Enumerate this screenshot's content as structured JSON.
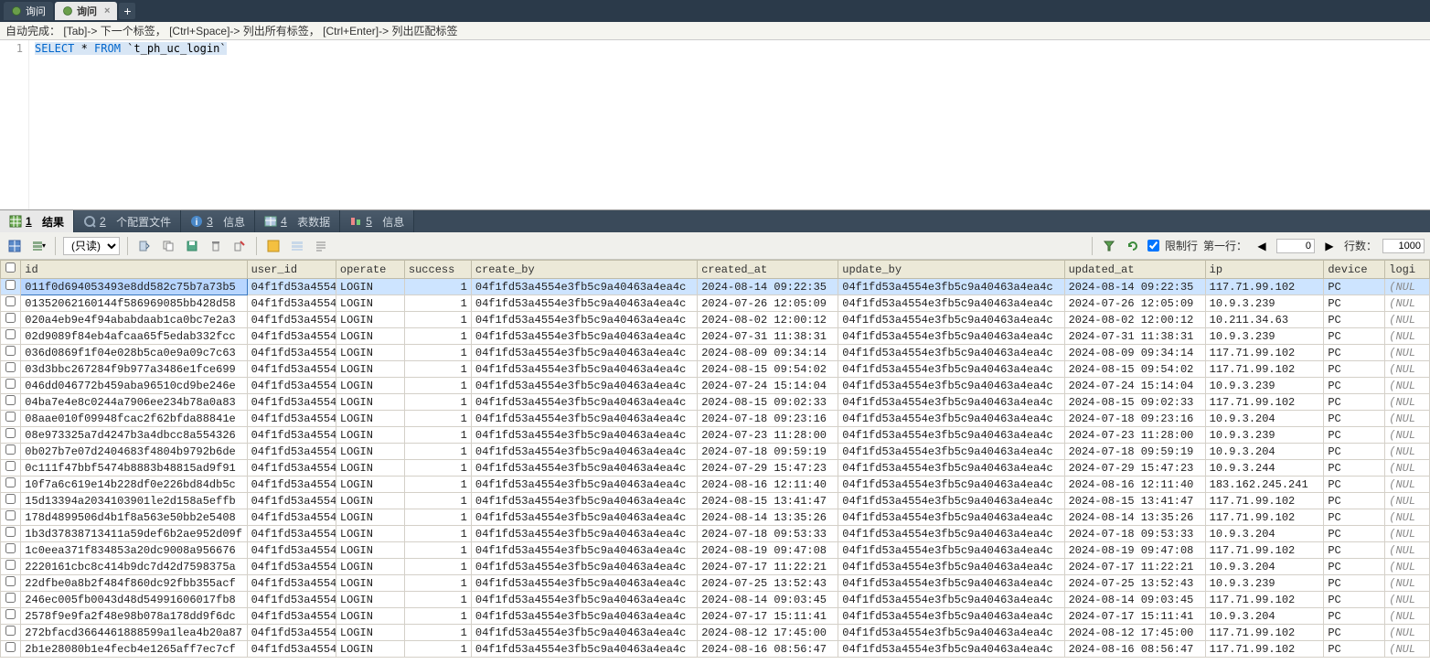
{
  "tabs": [
    {
      "label": "询问",
      "active": false
    },
    {
      "label": "询问",
      "active": true
    }
  ],
  "hints": {
    "auto": "自动完成：",
    "tab": "[Tab]-> 下一个标签，",
    "ctrlspace": "[Ctrl+Space]-> 列出所有标签，",
    "ctrlenter": "[Ctrl+Enter]-> 列出匹配标签"
  },
  "editor": {
    "line": "1",
    "sql_select": "SELECT",
    "sql_star": " * ",
    "sql_from": "FROM",
    "sql_table": " `t_ph_uc_login`"
  },
  "result_tabs": [
    {
      "num": "1",
      "label": "结果",
      "active": true
    },
    {
      "num": "2",
      "label": "个配置文件",
      "active": false
    },
    {
      "num": "3",
      "label": "信息",
      "active": false
    },
    {
      "num": "4",
      "label": "表数据",
      "active": false
    },
    {
      "num": "5",
      "label": "信息",
      "active": false
    }
  ],
  "toolbar": {
    "mode": "(只读)",
    "limit_label": "限制行",
    "firstrow_label": "第一行：",
    "firstrow_value": "0",
    "rows_label": "行数：",
    "rows_value": "1000"
  },
  "columns": [
    "id",
    "user_id",
    "operate",
    "success",
    "create_by",
    "created_at",
    "update_by",
    "updated_at",
    "ip",
    "device",
    "logi"
  ],
  "rows": [
    {
      "id": "011f0d694053493e8dd582c75b7a73b5",
      "user_id": "04f1fd53a4554",
      "operate": "LOGIN",
      "success": "1",
      "create_by": "04f1fd53a4554e3fb5c9a40463a4ea4c",
      "created_at": "2024-08-14 09:22:35",
      "update_by": "04f1fd53a4554e3fb5c9a40463a4ea4c",
      "updated_at": "2024-08-14 09:22:35",
      "ip": "117.71.99.102",
      "device": "PC",
      "login": "(NUL"
    },
    {
      "id": "01352062160144f586969085bb428d58",
      "user_id": "04f1fd53a4554",
      "operate": "LOGIN",
      "success": "1",
      "create_by": "04f1fd53a4554e3fb5c9a40463a4ea4c",
      "created_at": "2024-07-26 12:05:09",
      "update_by": "04f1fd53a4554e3fb5c9a40463a4ea4c",
      "updated_at": "2024-07-26 12:05:09",
      "ip": "10.9.3.239",
      "device": "PC",
      "login": "(NUL"
    },
    {
      "id": "020a4eb9e4f94ababdaab1ca0bc7e2a3",
      "user_id": "04f1fd53a4554",
      "operate": "LOGIN",
      "success": "1",
      "create_by": "04f1fd53a4554e3fb5c9a40463a4ea4c",
      "created_at": "2024-08-02 12:00:12",
      "update_by": "04f1fd53a4554e3fb5c9a40463a4ea4c",
      "updated_at": "2024-08-02 12:00:12",
      "ip": "10.211.34.63",
      "device": "PC",
      "login": "(NUL"
    },
    {
      "id": "02d9089f84eb4afcaa65f5edab332fcc",
      "user_id": "04f1fd53a4554",
      "operate": "LOGIN",
      "success": "1",
      "create_by": "04f1fd53a4554e3fb5c9a40463a4ea4c",
      "created_at": "2024-07-31 11:38:31",
      "update_by": "04f1fd53a4554e3fb5c9a40463a4ea4c",
      "updated_at": "2024-07-31 11:38:31",
      "ip": "10.9.3.239",
      "device": "PC",
      "login": "(NUL"
    },
    {
      "id": "036d0869f1f04e028b5ca0e9a09c7c63",
      "user_id": "04f1fd53a4554",
      "operate": "LOGIN",
      "success": "1",
      "create_by": "04f1fd53a4554e3fb5c9a40463a4ea4c",
      "created_at": "2024-08-09 09:34:14",
      "update_by": "04f1fd53a4554e3fb5c9a40463a4ea4c",
      "updated_at": "2024-08-09 09:34:14",
      "ip": "117.71.99.102",
      "device": "PC",
      "login": "(NUL"
    },
    {
      "id": "03d3bbc267284f9b977a3486e1fce699",
      "user_id": "04f1fd53a4554",
      "operate": "LOGIN",
      "success": "1",
      "create_by": "04f1fd53a4554e3fb5c9a40463a4ea4c",
      "created_at": "2024-08-15 09:54:02",
      "update_by": "04f1fd53a4554e3fb5c9a40463a4ea4c",
      "updated_at": "2024-08-15 09:54:02",
      "ip": "117.71.99.102",
      "device": "PC",
      "login": "(NUL"
    },
    {
      "id": "046dd046772b459aba96510cd9be246e",
      "user_id": "04f1fd53a4554",
      "operate": "LOGIN",
      "success": "1",
      "create_by": "04f1fd53a4554e3fb5c9a40463a4ea4c",
      "created_at": "2024-07-24 15:14:04",
      "update_by": "04f1fd53a4554e3fb5c9a40463a4ea4c",
      "updated_at": "2024-07-24 15:14:04",
      "ip": "10.9.3.239",
      "device": "PC",
      "login": "(NUL"
    },
    {
      "id": "04ba7e4e8c0244a7906ee234b78a0a83",
      "user_id": "04f1fd53a4554",
      "operate": "LOGIN",
      "success": "1",
      "create_by": "04f1fd53a4554e3fb5c9a40463a4ea4c",
      "created_at": "2024-08-15 09:02:33",
      "update_by": "04f1fd53a4554e3fb5c9a40463a4ea4c",
      "updated_at": "2024-08-15 09:02:33",
      "ip": "117.71.99.102",
      "device": "PC",
      "login": "(NUL"
    },
    {
      "id": "08aae010f09948fcac2f62bfda88841e",
      "user_id": "04f1fd53a4554",
      "operate": "LOGIN",
      "success": "1",
      "create_by": "04f1fd53a4554e3fb5c9a40463a4ea4c",
      "created_at": "2024-07-18 09:23:16",
      "update_by": "04f1fd53a4554e3fb5c9a40463a4ea4c",
      "updated_at": "2024-07-18 09:23:16",
      "ip": "10.9.3.204",
      "device": "PC",
      "login": "(NUL"
    },
    {
      "id": "08e973325a7d4247b3a4dbcc8a554326",
      "user_id": "04f1fd53a4554",
      "operate": "LOGIN",
      "success": "1",
      "create_by": "04f1fd53a4554e3fb5c9a40463a4ea4c",
      "created_at": "2024-07-23 11:28:00",
      "update_by": "04f1fd53a4554e3fb5c9a40463a4ea4c",
      "updated_at": "2024-07-23 11:28:00",
      "ip": "10.9.3.239",
      "device": "PC",
      "login": "(NUL"
    },
    {
      "id": "0b027b7e07d2404683f4804b9792b6de",
      "user_id": "04f1fd53a4554",
      "operate": "LOGIN",
      "success": "1",
      "create_by": "04f1fd53a4554e3fb5c9a40463a4ea4c",
      "created_at": "2024-07-18 09:59:19",
      "update_by": "04f1fd53a4554e3fb5c9a40463a4ea4c",
      "updated_at": "2024-07-18 09:59:19",
      "ip": "10.9.3.204",
      "device": "PC",
      "login": "(NUL"
    },
    {
      "id": "0c111f47bbf5474b8883b48815ad9f91",
      "user_id": "04f1fd53a4554",
      "operate": "LOGIN",
      "success": "1",
      "create_by": "04f1fd53a4554e3fb5c9a40463a4ea4c",
      "created_at": "2024-07-29 15:47:23",
      "update_by": "04f1fd53a4554e3fb5c9a40463a4ea4c",
      "updated_at": "2024-07-29 15:47:23",
      "ip": "10.9.3.244",
      "device": "PC",
      "login": "(NUL"
    },
    {
      "id": "10f7a6c619e14b228df0e226bd84db5c",
      "user_id": "04f1fd53a4554",
      "operate": "LOGIN",
      "success": "1",
      "create_by": "04f1fd53a4554e3fb5c9a40463a4ea4c",
      "created_at": "2024-08-16 12:11:40",
      "update_by": "04f1fd53a4554e3fb5c9a40463a4ea4c",
      "updated_at": "2024-08-16 12:11:40",
      "ip": "183.162.245.241",
      "device": "PC",
      "login": "(NUL"
    },
    {
      "id": "15d13394a2034103901le2d158a5effb",
      "user_id": "04f1fd53a4554",
      "operate": "LOGIN",
      "success": "1",
      "create_by": "04f1fd53a4554e3fb5c9a40463a4ea4c",
      "created_at": "2024-08-15 13:41:47",
      "update_by": "04f1fd53a4554e3fb5c9a40463a4ea4c",
      "updated_at": "2024-08-15 13:41:47",
      "ip": "117.71.99.102",
      "device": "PC",
      "login": "(NUL"
    },
    {
      "id": "178d4899506d4b1f8a563e50bb2e5408",
      "user_id": "04f1fd53a4554",
      "operate": "LOGIN",
      "success": "1",
      "create_by": "04f1fd53a4554e3fb5c9a40463a4ea4c",
      "created_at": "2024-08-14 13:35:26",
      "update_by": "04f1fd53a4554e3fb5c9a40463a4ea4c",
      "updated_at": "2024-08-14 13:35:26",
      "ip": "117.71.99.102",
      "device": "PC",
      "login": "(NUL"
    },
    {
      "id": "1b3d37838713411a59def6b2ae952d09f",
      "user_id": "04f1fd53a4554",
      "operate": "LOGIN",
      "success": "1",
      "create_by": "04f1fd53a4554e3fb5c9a40463a4ea4c",
      "created_at": "2024-07-18 09:53:33",
      "update_by": "04f1fd53a4554e3fb5c9a40463a4ea4c",
      "updated_at": "2024-07-18 09:53:33",
      "ip": "10.9.3.204",
      "device": "PC",
      "login": "(NUL"
    },
    {
      "id": "1c0eea371f834853a20dc9008a956676",
      "user_id": "04f1fd53a4554",
      "operate": "LOGIN",
      "success": "1",
      "create_by": "04f1fd53a4554e3fb5c9a40463a4ea4c",
      "created_at": "2024-08-19 09:47:08",
      "update_by": "04f1fd53a4554e3fb5c9a40463a4ea4c",
      "updated_at": "2024-08-19 09:47:08",
      "ip": "117.71.99.102",
      "device": "PC",
      "login": "(NUL"
    },
    {
      "id": "2220161cbc8c414b9dc7d42d7598375a",
      "user_id": "04f1fd53a4554",
      "operate": "LOGIN",
      "success": "1",
      "create_by": "04f1fd53a4554e3fb5c9a40463a4ea4c",
      "created_at": "2024-07-17 11:22:21",
      "update_by": "04f1fd53a4554e3fb5c9a40463a4ea4c",
      "updated_at": "2024-07-17 11:22:21",
      "ip": "10.9.3.204",
      "device": "PC",
      "login": "(NUL"
    },
    {
      "id": "22dfbe0a8b2f484f860dc92fbb355acf",
      "user_id": "04f1fd53a4554",
      "operate": "LOGIN",
      "success": "1",
      "create_by": "04f1fd53a4554e3fb5c9a40463a4ea4c",
      "created_at": "2024-07-25 13:52:43",
      "update_by": "04f1fd53a4554e3fb5c9a40463a4ea4c",
      "updated_at": "2024-07-25 13:52:43",
      "ip": "10.9.3.239",
      "device": "PC",
      "login": "(NUL"
    },
    {
      "id": "246ec005fb0043d48d54991606017fb8",
      "user_id": "04f1fd53a4554",
      "operate": "LOGIN",
      "success": "1",
      "create_by": "04f1fd53a4554e3fb5c9a40463a4ea4c",
      "created_at": "2024-08-14 09:03:45",
      "update_by": "04f1fd53a4554e3fb5c9a40463a4ea4c",
      "updated_at": "2024-08-14 09:03:45",
      "ip": "117.71.99.102",
      "device": "PC",
      "login": "(NUL"
    },
    {
      "id": "2578f9e9fa2f48e98b078a178dd9f6dc",
      "user_id": "04f1fd53a4554",
      "operate": "LOGIN",
      "success": "1",
      "create_by": "04f1fd53a4554e3fb5c9a40463a4ea4c",
      "created_at": "2024-07-17 15:11:41",
      "update_by": "04f1fd53a4554e3fb5c9a40463a4ea4c",
      "updated_at": "2024-07-17 15:11:41",
      "ip": "10.9.3.204",
      "device": "PC",
      "login": "(NUL"
    },
    {
      "id": "272bfacd3664461888599a1lea4b20a87",
      "user_id": "04f1fd53a4554",
      "operate": "LOGIN",
      "success": "1",
      "create_by": "04f1fd53a4554e3fb5c9a40463a4ea4c",
      "created_at": "2024-08-12 17:45:00",
      "update_by": "04f1fd53a4554e3fb5c9a40463a4ea4c",
      "updated_at": "2024-08-12 17:45:00",
      "ip": "117.71.99.102",
      "device": "PC",
      "login": "(NUL"
    },
    {
      "id": "2b1e28080b1e4fecb4e1265aff7ec7cf",
      "user_id": "04f1fd53a4554",
      "operate": "LOGIN",
      "success": "1",
      "create_by": "04f1fd53a4554e3fb5c9a40463a4ea4c",
      "created_at": "2024-08-16 08:56:47",
      "update_by": "04f1fd53a4554e3fb5c9a40463a4ea4c",
      "updated_at": "2024-08-16 08:56:47",
      "ip": "117.71.99.102",
      "device": "PC",
      "login": "(NUL"
    }
  ]
}
